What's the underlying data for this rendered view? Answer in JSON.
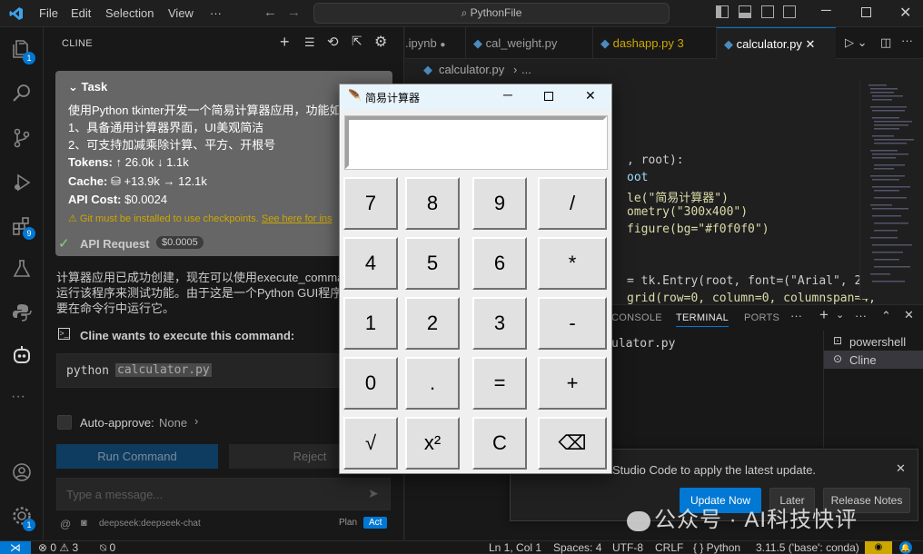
{
  "titlebar": {
    "menus": [
      "File",
      "Edit",
      "Selection",
      "View",
      "···"
    ],
    "search": "PythonFile"
  },
  "activity": {
    "badges": [
      "1",
      "9",
      "1"
    ]
  },
  "cline": {
    "header": "CLINE",
    "task_label": "Task",
    "task_text_1": "使用Python tkinter开发一个简易计算器应用，功能如",
    "task_text_2": "1、具备通用计算器界面，UI美观简洁",
    "task_text_3": "2、可支持加减乘除计算、平方、开根号",
    "tokens_label": "Tokens:",
    "tokens_value": "↑ 26.0k ↓ 1.1k",
    "cache_label": "Cache:",
    "cache_value": "⛁ +13.9k → 12.1k",
    "api_cost_label": "API Cost:",
    "api_cost_value": "$0.0024",
    "warning_text": "Git must be installed to use checkpoints.",
    "warning_link": "See here for ins",
    "api_request_label": "API Request",
    "api_request_cost": "$0.0005",
    "message_1": "计算器应用已成功创建，现在可以使用execute_comma",
    "message_2": "运行该程序来测试功能。由于这是一个Python GUI程序",
    "message_3": "要在命令行中运行它。",
    "execute_label": "Cline wants to execute this command:",
    "command_prefix": "python",
    "command_file": "calculator.py",
    "auto_approve_label": "Auto-approve:",
    "auto_approve_value": "None",
    "run_command": "Run Command",
    "reject": "Reject",
    "message_placeholder": "Type a message...",
    "model": "deepseek:deepseek-chat",
    "plan": "Plan",
    "act": "Act"
  },
  "tabs": [
    {
      "label": ".ipynb",
      "modified": true
    },
    {
      "label": "cal_weight.py"
    },
    {
      "label": "dashapp.py",
      "count": "3"
    },
    {
      "label": "calculator.py",
      "active": true
    }
  ],
  "breadcrumb": {
    "file": "calculator.py",
    "rest": "..."
  },
  "code_lines": [
    ", root):",
    "oot",
    "le(\"简易计算器\")",
    "ometry(\"300x400\")",
    "figure(bg=\"#f0f0f0\")",
    "",
    "",
    "= tk.Entry(root, font=(\"Arial\", 24)",
    "grid(row=0, column=0, columnspan=4,"
  ],
  "panel": {
    "tabs": [
      "CONSOLE",
      "TERMINAL",
      "PORTS"
    ],
    "terminal_text": "ulator.py",
    "terminals": [
      "powershell",
      "Cline"
    ]
  },
  "notification": {
    "text": "Studio Code to apply the latest update.",
    "update_now": "Update Now",
    "later": "Later",
    "release_notes": "Release Notes"
  },
  "statusbar": {
    "problems": "⊗ 0 ⚠ 3",
    "ports": "⍉ 0",
    "position": "Ln 1, Col 1",
    "spaces": "Spaces: 4",
    "encoding": "UTF-8",
    "eol": "CRLF",
    "language": "{ } Python",
    "interpreter": "3.11.5 ('base': conda)"
  },
  "calculator": {
    "title": "简易计算器",
    "display": "",
    "keys": [
      [
        "7",
        "8",
        "9",
        "/"
      ],
      [
        "4",
        "5",
        "6",
        "*"
      ],
      [
        "1",
        "2",
        "3",
        "-"
      ],
      [
        "0",
        ".",
        "=",
        "+"
      ],
      [
        "√",
        "x²",
        "C",
        "⌫"
      ]
    ]
  },
  "watermark": "公众号 · AI科技快评",
  "colors": {
    "accent": "#0078d4",
    "editor_bg": "#1f1f1f",
    "sidebar_bg": "#181818",
    "task_bg": "#666666",
    "calc_bg": "#f0f0f0"
  }
}
